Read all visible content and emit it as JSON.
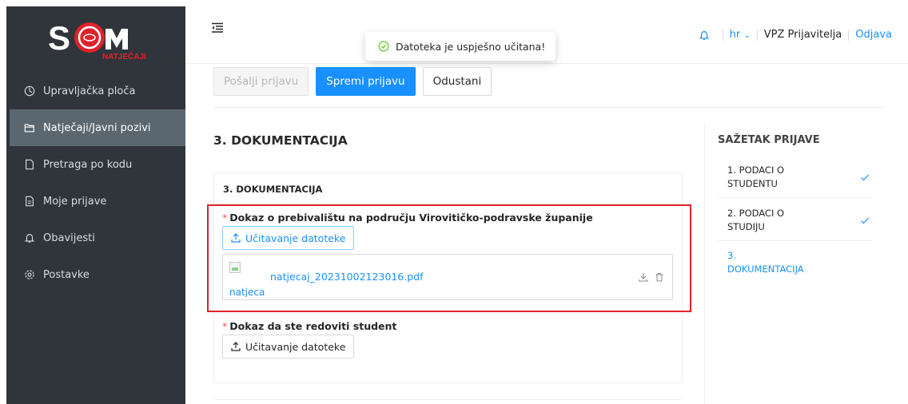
{
  "brand": {
    "logo_text": "SOM",
    "logo_sub": "NATJEČAJI",
    "accent": "#e0222b"
  },
  "sidebar": {
    "items": [
      {
        "label": "Upravljačka ploča",
        "icon": "dashboard-icon"
      },
      {
        "label": "Natječaji/Javni pozivi",
        "icon": "folder-open-icon",
        "active": true
      },
      {
        "label": "Pretraga po kodu",
        "icon": "file-icon"
      },
      {
        "label": "Moje prijave",
        "icon": "file-text-icon"
      },
      {
        "label": "Obavijesti",
        "icon": "bell-icon"
      },
      {
        "label": "Postavke",
        "icon": "gear-icon"
      }
    ]
  },
  "topbar": {
    "lang": "hr",
    "user": "VPZ Prijavitelja",
    "logout": "Odjava"
  },
  "toast": {
    "message": "Datoteka je uspješno učitana!"
  },
  "actions": {
    "send": "Pošalji prijavu",
    "save": "Spremi prijavu",
    "cancel": "Odustani"
  },
  "section": {
    "title": "3. DOKUMENTACIJA",
    "card_title": "3. DOKUMENTACIJA",
    "fields": [
      {
        "label": "Dokaz o prebivalištu na području Virovitičko-podravske županije",
        "upload_label": "Učitavanje datoteke",
        "file": {
          "name": "natjecaj_20231002123016.pdf",
          "thumb_alt": "natjecaj_20231002123016.pdf"
        }
      },
      {
        "label": "Dokaz da ste redoviti student",
        "upload_label": "Učitavanje datoteke"
      }
    ]
  },
  "summary": {
    "title": "SAŽETAK PRIJAVE",
    "items": [
      {
        "label": "1. PODACI O STUDENTU",
        "done": true
      },
      {
        "label": "2. PODACI O STUDIJU",
        "done": true
      },
      {
        "label": "3. DOKUMENTACIJA",
        "done": false,
        "active": true
      }
    ]
  },
  "colors": {
    "primary": "#1890ff",
    "sidebar_bg": "#2f353b",
    "sidebar_active": "#5b6770",
    "success": "#52c41a"
  }
}
